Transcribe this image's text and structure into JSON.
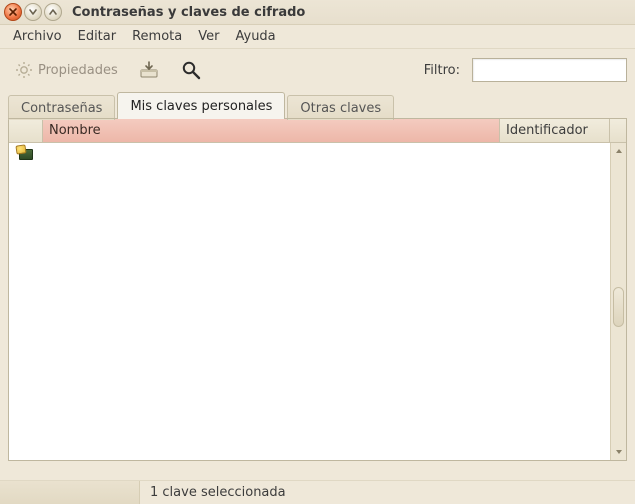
{
  "window": {
    "title": "Contraseñas y claves de cifrado"
  },
  "menubar": {
    "archivo": "Archivo",
    "editar": "Editar",
    "remota": "Remota",
    "ver": "Ver",
    "ayuda": "Ayuda"
  },
  "toolbar": {
    "propiedades_label": "Propiedades",
    "filter_label": "Filtro:",
    "filter_value": ""
  },
  "tabs": {
    "contrasenas": "Contraseñas",
    "mis_claves": "Mis claves personales",
    "otras_claves": "Otras claves"
  },
  "columns": {
    "nombre": "Nombre",
    "identificador": "Identificador"
  },
  "rows": [
    {
      "icon": "key-icon",
      "nombre": "",
      "identificador": ""
    }
  ],
  "status": {
    "text": "1 clave seleccionada"
  }
}
